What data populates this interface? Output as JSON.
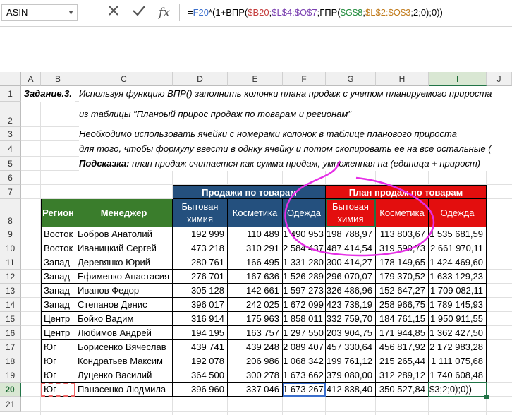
{
  "formula_bar": {
    "name_box": "ASIN",
    "cancel_icon": "✕",
    "enter_icon": "✓",
    "fx_label": "fx",
    "formula_parts": [
      "=",
      "F20",
      "*(1+ВПР(",
      "$B20",
      ";",
      "$L$4:$O$7",
      ";ГПР(",
      "$G$8",
      ";",
      "$L$2:$O$3",
      ";2;0);0))"
    ]
  },
  "columns": [
    "A",
    "B",
    "C",
    "D",
    "E",
    "F",
    "G",
    "H",
    "I",
    "J"
  ],
  "rows": [
    "1",
    "2",
    "3",
    "4",
    "5",
    "6",
    "7",
    "8",
    "9",
    "10",
    "11",
    "12",
    "13",
    "14",
    "15",
    "16",
    "17",
    "18",
    "19",
    "20",
    "21"
  ],
  "task": {
    "label": "Задание.3.",
    "line1": "Используя функцию ВПР() заполнить колонки плана продаж с учетом планируемого прироста",
    "line2": "из таблицы \"Планоый прирос продаж по товарам и регионам\"",
    "line3": "Необходимо использовать ячейки с номерами колонок в таблице планового прироста",
    "line4": "для того, чтобы формулу ввести в однку ячейку и потом скопировать ее на все остальные (",
    "hint_label": "Подсказка:",
    "hint_text": " план продаж считается как сумма продаж, умноженная на (единица + прирост)"
  },
  "table": {
    "group_sales": "Продажи по товарам",
    "group_plan": "План продаж по товарам",
    "col_region": "Регион",
    "col_manager": "Менеджер",
    "col_household": "Бытовая химия",
    "col_cosmetics": "Косметика",
    "col_clothes": "Одежда",
    "col_plan_household": "Бытовая химия",
    "col_plan_cosmetics": "Косметика",
    "col_plan_clothes": "Одежда",
    "rows": [
      {
        "region": "Восток",
        "manager": "Бобров Анатолий",
        "d": "192 999",
        "e": "110 489",
        "f": "1 490 953",
        "g": "198 788,97",
        "h": "113 803,67",
        "i": "1 535 681,59"
      },
      {
        "region": "Восток",
        "manager": "Иваницкий Сергей",
        "d": "473 218",
        "e": "310 291",
        "f": "2 584 437",
        "g": "487 414,54",
        "h": "319 599,73",
        "i": "2 661 970,11"
      },
      {
        "region": "Запад",
        "manager": "Деревянко Юрий",
        "d": "280 761",
        "e": "166 495",
        "f": "1 331 280",
        "g": "300 414,27",
        "h": "178 149,65",
        "i": "1 424 469,60"
      },
      {
        "region": "Запад",
        "manager": "Ефименко Анастасия",
        "d": "276 701",
        "e": "167 636",
        "f": "1 526 289",
        "g": "296 070,07",
        "h": "179 370,52",
        "i": "1 633 129,23"
      },
      {
        "region": "Запад",
        "manager": "Иванов Федор",
        "d": "305 128",
        "e": "142 661",
        "f": "1 597 273",
        "g": "326 486,96",
        "h": "152 647,27",
        "i": "1 709 082,11"
      },
      {
        "region": "Запад",
        "manager": "Степанов Денис",
        "d": "396 017",
        "e": "242 025",
        "f": "1 672 099",
        "g": "423 738,19",
        "h": "258 966,75",
        "i": "1 789 145,93"
      },
      {
        "region": "Центр",
        "manager": "Бойко Вадим",
        "d": "316 914",
        "e": "175 963",
        "f": "1 858 011",
        "g": "332 759,70",
        "h": "184 761,15",
        "i": "1 950 911,55"
      },
      {
        "region": "Центр",
        "manager": "Любимов Андрей",
        "d": "194 195",
        "e": "163 757",
        "f": "1 297 550",
        "g": "203 904,75",
        "h": "171 944,85",
        "i": "1 362 427,50"
      },
      {
        "region": "Юг",
        "manager": "Борисенко Вячеслав",
        "d": "439 741",
        "e": "439 248",
        "f": "2 089 407",
        "g": "457 330,64",
        "h": "456 817,92",
        "i": "2 172 983,28"
      },
      {
        "region": "Юг",
        "manager": "Кондратьев Максим",
        "d": "192 078",
        "e": "206 986",
        "f": "1 068 342",
        "g": "199 761,12",
        "h": "215 265,44",
        "i": "1 111 075,68"
      },
      {
        "region": "Юг",
        "manager": "Луценко Василий",
        "d": "364 500",
        "e": "300 278",
        "f": "1 673 662",
        "g": "379 080,00",
        "h": "312 289,12",
        "i": "1 740 608,48"
      },
      {
        "region": "Юг",
        "manager": "Панасенко Людмила",
        "d": "396 960",
        "e": "337 046",
        "f": "1 673 267",
        "g": "412 838,40",
        "h": "350 527,84",
        "i": "$3;2;0);0))"
      }
    ]
  },
  "colors": {
    "green_header": "#3a7d2c",
    "blue_header": "#24507e",
    "red_header": "#e30e0e",
    "annotation": "#e62ee6",
    "selection": "#217346"
  }
}
